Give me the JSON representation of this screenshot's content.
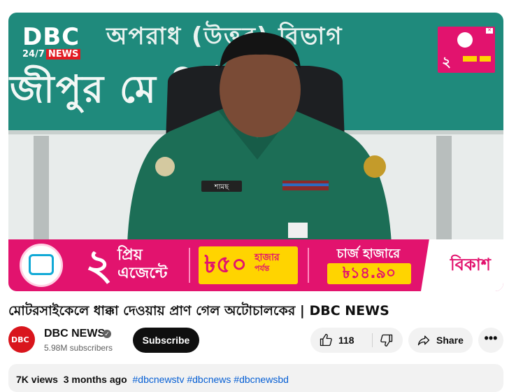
{
  "video": {
    "overlay_logo_main": "DBC",
    "overlay_logo_sub": "24/7",
    "overlay_logo_news": "NEWS",
    "banner_line1": "অপরাধ (উত্তর) বিভাগ",
    "banner_line2": "জীপুর মে লিটন পুলি",
    "name_tag": "শামছ",
    "corner_ad_number": "২",
    "ad": {
      "big_number": "২",
      "priyo_line1": "প্রিয়",
      "priyo_line2": "এজেন্টে",
      "amount": "৳৫০",
      "amount_unit_line1": "হাজার",
      "amount_unit_line2": "পর্যন্ত",
      "charge_label": "চার্জ হাজারে",
      "charge_price": "৳১৪.৯০",
      "brand": "বিকাশ"
    },
    "colors": {
      "banner": "#1f8a7c",
      "ad_pink": "#e2136e",
      "ad_yellow": "#ffd400",
      "uniform": "#1c6e56"
    }
  },
  "title": "মোটরসাইকেলে ধাক্কা দেওয়ায় প্রাণ গেল অটোচালকের | DBC NEWS",
  "channel": {
    "avatar_text": "DBC",
    "name": "DBC NEWS",
    "subscribers": "5.98M subscribers",
    "subscribe_label": "Subscribe"
  },
  "actions": {
    "like_count": "118",
    "share_label": "Share",
    "more_label": "•••"
  },
  "description": {
    "views": "7K views",
    "age": "3 months ago",
    "tags": [
      "#dbcnewstv",
      "#dbcnews",
      "#dbcnewsbd"
    ]
  },
  "icons": [
    "verified-badge-icon",
    "thumbs-up-icon",
    "thumbs-down-icon",
    "share-arrow-icon",
    "more-dots-icon",
    "close-ad-icon"
  ]
}
